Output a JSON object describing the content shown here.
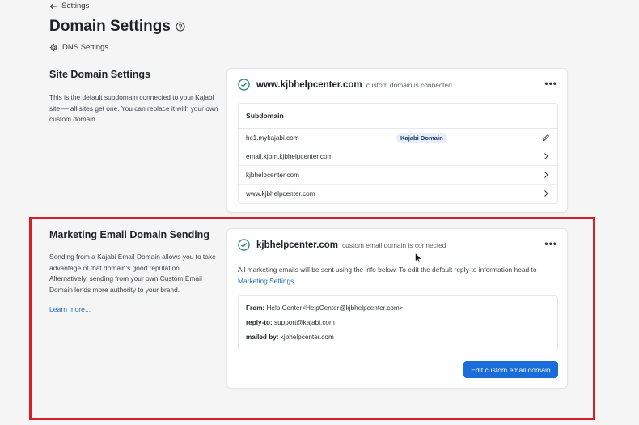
{
  "header": {
    "back_label": "Settings",
    "title": "Domain Settings",
    "dns_label": "DNS Settings"
  },
  "site_domain": {
    "title": "Site Domain Settings",
    "description": "This is the default subdomain connected to your Kajabi site — all sites get one. You can replace it with your own custom domain.",
    "card": {
      "domain": "www.kjbhelpcenter.com",
      "status": "custom domain is connected",
      "table_header": "Subdomain",
      "rows": [
        {
          "name": "hc1.mykajabi.com",
          "badge": "Kajabi Domain",
          "icon": "pencil-icon"
        },
        {
          "name": "email.kjbm.kjbhelpcenter.com",
          "badge": "",
          "icon": "chevron-right-icon"
        },
        {
          "name": "kjbhelpcenter.com",
          "badge": "",
          "icon": "chevron-right-icon"
        },
        {
          "name": "www.kjbhelpcenter.com",
          "badge": "",
          "icon": "chevron-right-icon"
        }
      ]
    }
  },
  "email_domain": {
    "title": "Marketing Email Domain Sending",
    "description": "Sending from a Kajabi Email Domain allows you to take advantage of that domain's good reputation. Alternatively, sending from your own Custom Email Domain lends more authority to your brand.",
    "learn_more": "Learn more...",
    "card": {
      "domain": "kjbhelpcenter.com",
      "status": "custom email domain is connected",
      "info_text": "All marketing emails will be sent using the info below. To edit the default reply-to information head to",
      "info_link": "Marketing Settings.",
      "from_label": "From:",
      "from_value": "Help Center<HelpCenter@kjbhelpcenter.com>",
      "reply_label": "reply-to:",
      "reply_value": "support@kajabi.com",
      "mailed_label": "mailed by:",
      "mailed_value": "kjbhelpcenter.com",
      "button_label": "Edit custom email domain"
    }
  },
  "colors": {
    "accent": "#1a6dd8",
    "check": "#2e8a6e",
    "highlight": "#d41e28"
  }
}
